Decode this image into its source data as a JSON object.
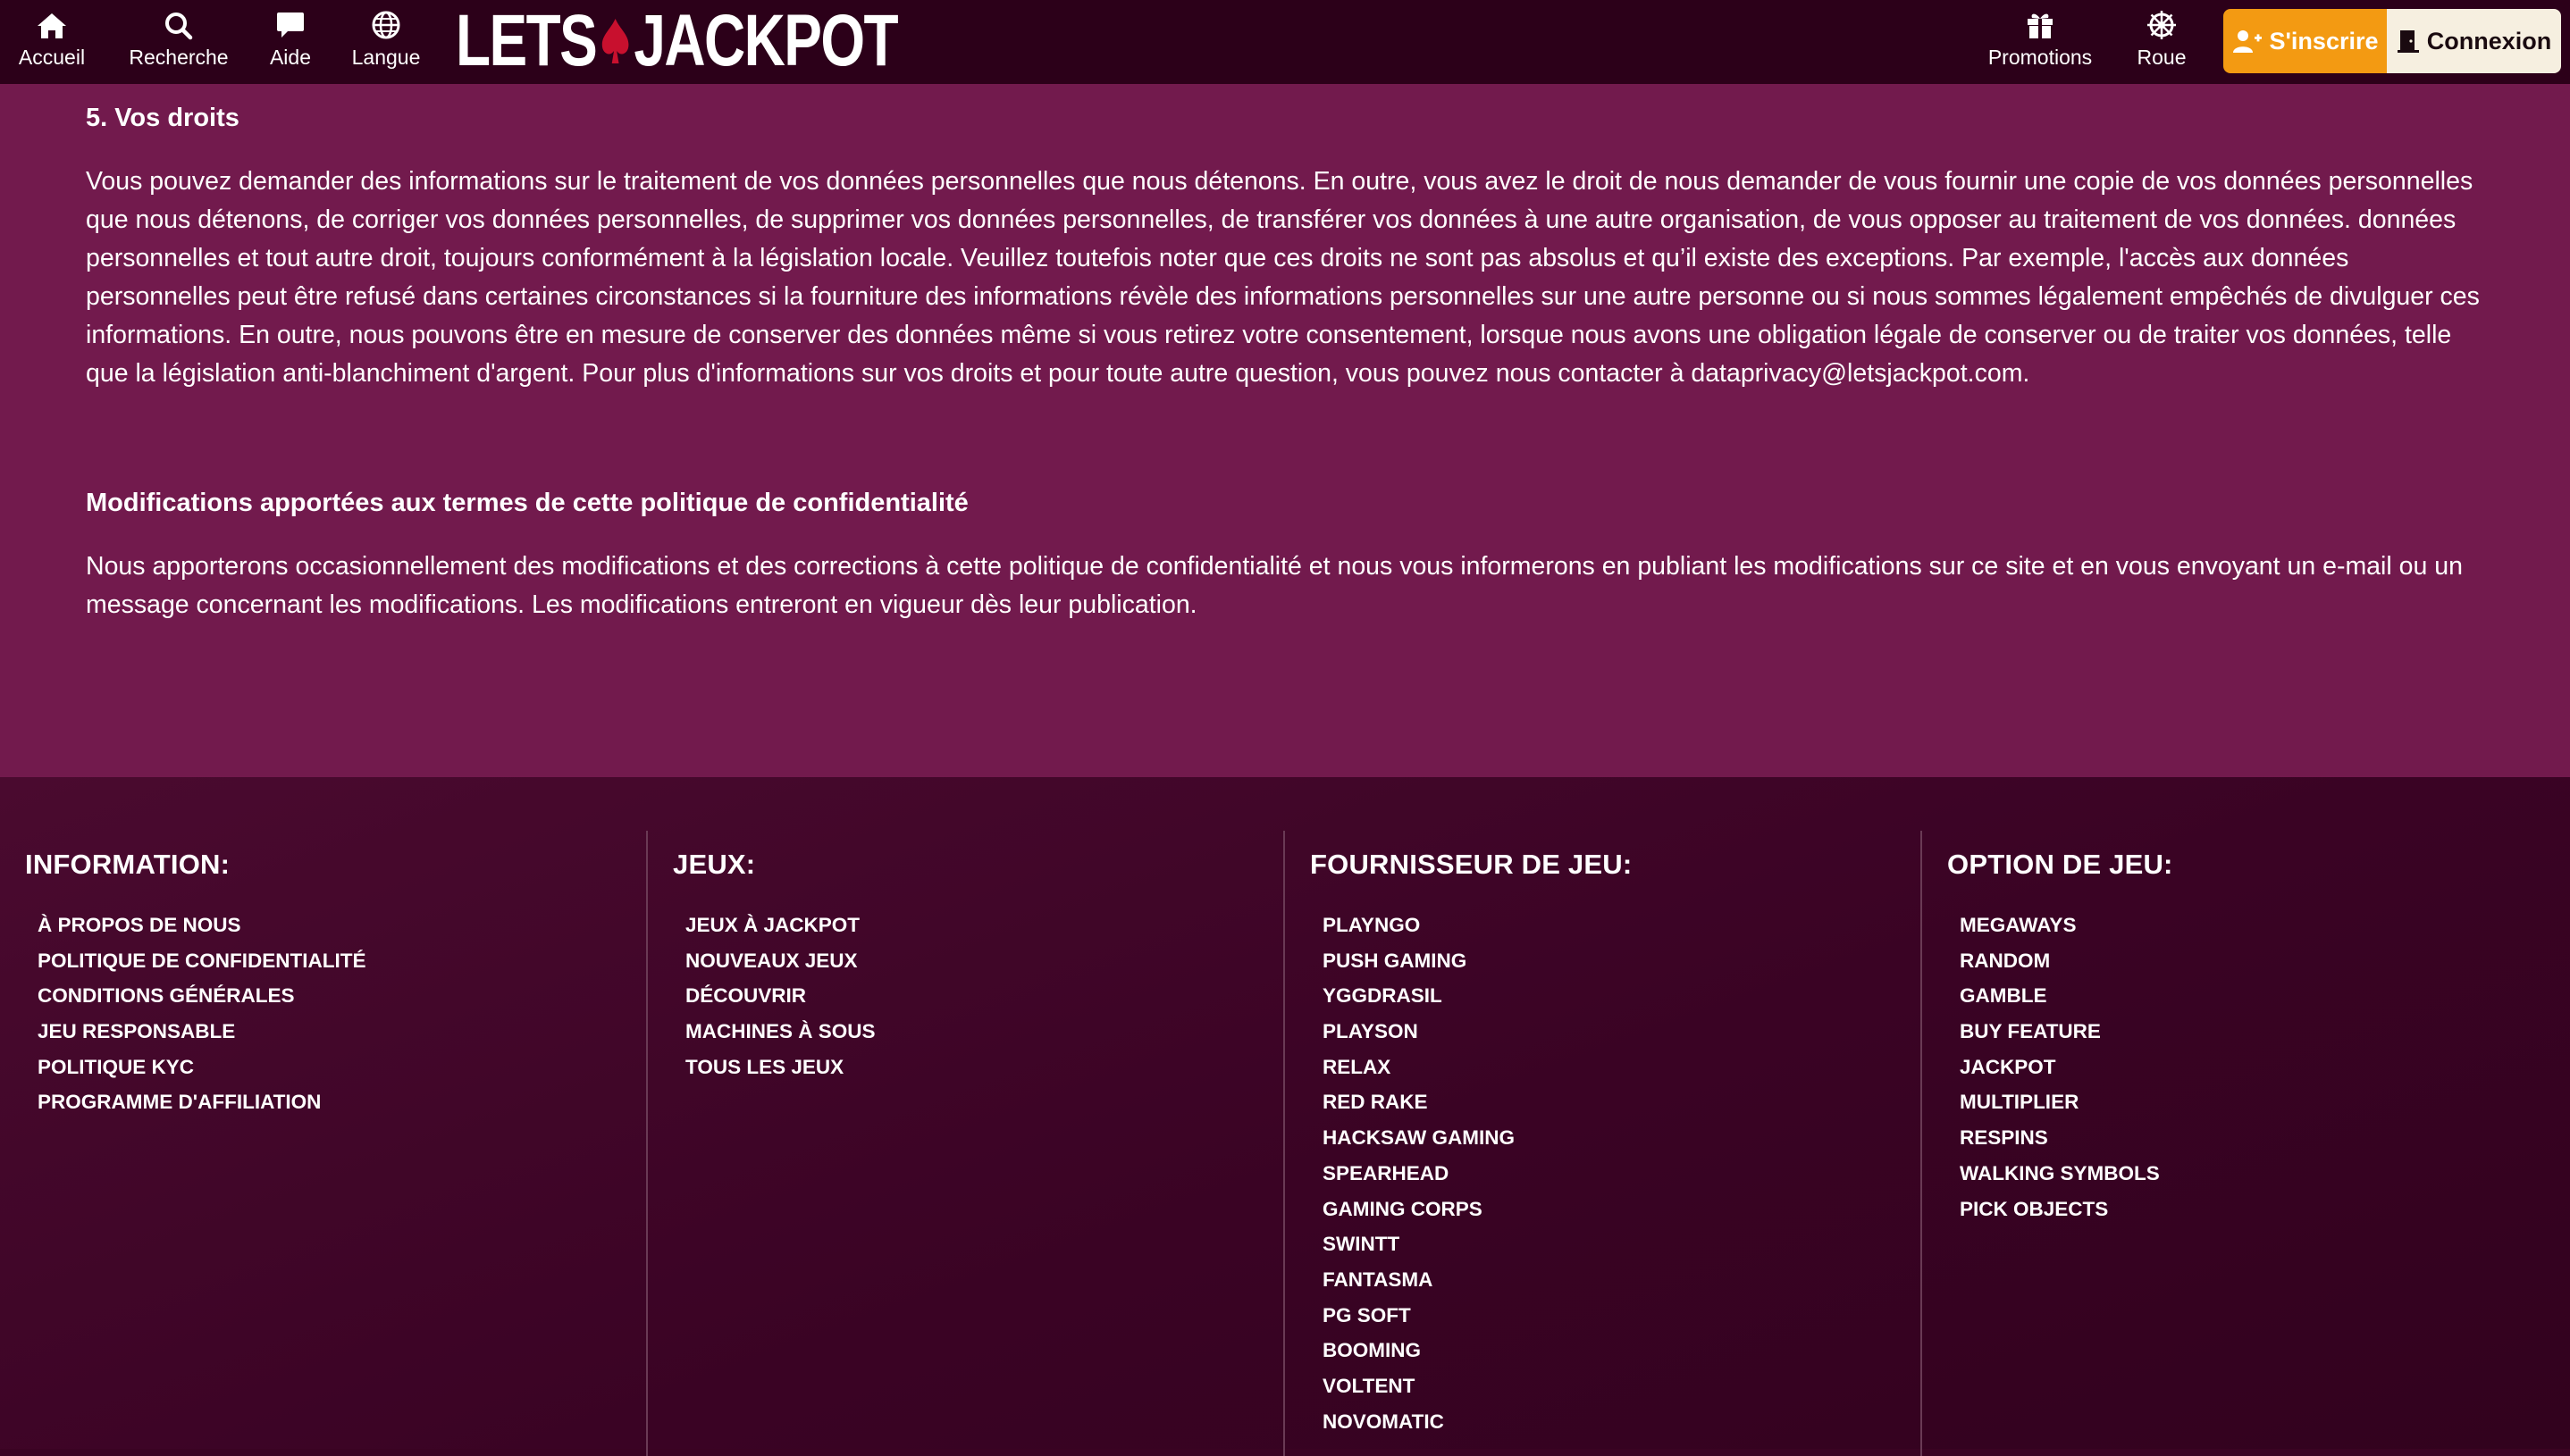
{
  "header": {
    "nav": [
      {
        "label": "Accueil",
        "icon": "home-icon"
      },
      {
        "label": "Recherche",
        "icon": "search-icon"
      },
      {
        "label": "Aide",
        "icon": "chat-bubble-icon"
      },
      {
        "label": "Langue",
        "icon": "globe-icon"
      }
    ],
    "logo": {
      "left": "LETS",
      "right": "JACKPOT"
    },
    "right_nav": [
      {
        "label": "Promotions",
        "icon": "gift-icon"
      },
      {
        "label": "Roue",
        "icon": "wheel-icon"
      }
    ],
    "register_label": "S'inscrire",
    "login_label": "Connexion"
  },
  "content": {
    "rights_title": "5. Vos droits",
    "rights_text": "Vous pouvez demander des informations sur le traitement de vos données personnelles que nous détenons. En outre, vous avez le droit de nous demander de vous fournir une copie de vos données personnelles que nous détenons, de corriger vos données personnelles, de supprimer vos données personnelles, de transférer vos données à une autre organisation, de vous opposer au traitement de vos données. données personnelles et tout autre droit, toujours conformément à la législation locale. Veuillez toutefois noter que ces droits ne sont pas absolus et qu’il existe des exceptions. Par exemple, l'accès aux données personnelles peut être refusé dans certaines circonstances si la fourniture des informations révèle des informations personnelles sur une autre personne ou si nous sommes légalement empêchés de divulguer ces informations. En outre, nous pouvons être en mesure de conserver des données même si vous retirez votre consentement, lorsque nous avons une obligation légale de conserver ou de traiter vos données, telle que la législation anti-blanchiment d'argent. Pour plus d'informations sur vos droits et pour toute autre question, vous pouvez nous contacter à dataprivacy@letsjackpot.com.",
    "changes_title": "Modifications apportées aux termes de cette politique de confidentialité",
    "changes_text": "Nous apporterons occasionnellement des modifications et des corrections à cette politique de confidentialité et nous vous informerons en publiant les modifications sur ce site et en vous envoyant un e-mail ou un message concernant les modifications. Les modifications entreront en vigueur dès leur publication."
  },
  "footer": {
    "columns": [
      {
        "title": "INFORMATION:",
        "items": [
          "À PROPOS DE NOUS",
          "POLITIQUE DE CONFIDENTIALITÉ",
          "CONDITIONS GÉNÉRALES",
          "JEU RESPONSABLE",
          "POLITIQUE KYC",
          "PROGRAMME D'AFFILIATION"
        ]
      },
      {
        "title": "JEUX:",
        "items": [
          "JEUX À JACKPOT",
          "NOUVEAUX JEUX",
          "DÉCOUVRIR",
          "MACHINES À SOUS",
          "TOUS LES JEUX"
        ]
      },
      {
        "title": "FOURNISSEUR DE JEU:",
        "items": [
          "PLAYNGO",
          "PUSH GAMING",
          "YGGDRASIL",
          "PLAYSON",
          "RELAX",
          "RED RAKE",
          "HACKSAW GAMING",
          "SPEARHEAD",
          "GAMING CORPS",
          "SWINTT",
          "FANTASMA",
          "PG SOFT",
          "BOOMING",
          "VOLTENT",
          "NOVOMATIC"
        ]
      },
      {
        "title": "OPTION DE JEU:",
        "items": [
          "MEGAWAYS",
          "RANDOM",
          "GAMBLE",
          "BUY FEATURE",
          "JACKPOT",
          "MULTIPLIER",
          "RESPINS",
          "WALKING SYMBOLS",
          "PICK OBJECTS"
        ]
      }
    ]
  },
  "colors": {
    "header_bg": "#2c0019",
    "content_bg": "#721a4d",
    "footer_bg": "#3a0324",
    "register_bg": "#f39a12",
    "login_bg": "#f6efe0",
    "logo_spade": "#c8102e"
  }
}
